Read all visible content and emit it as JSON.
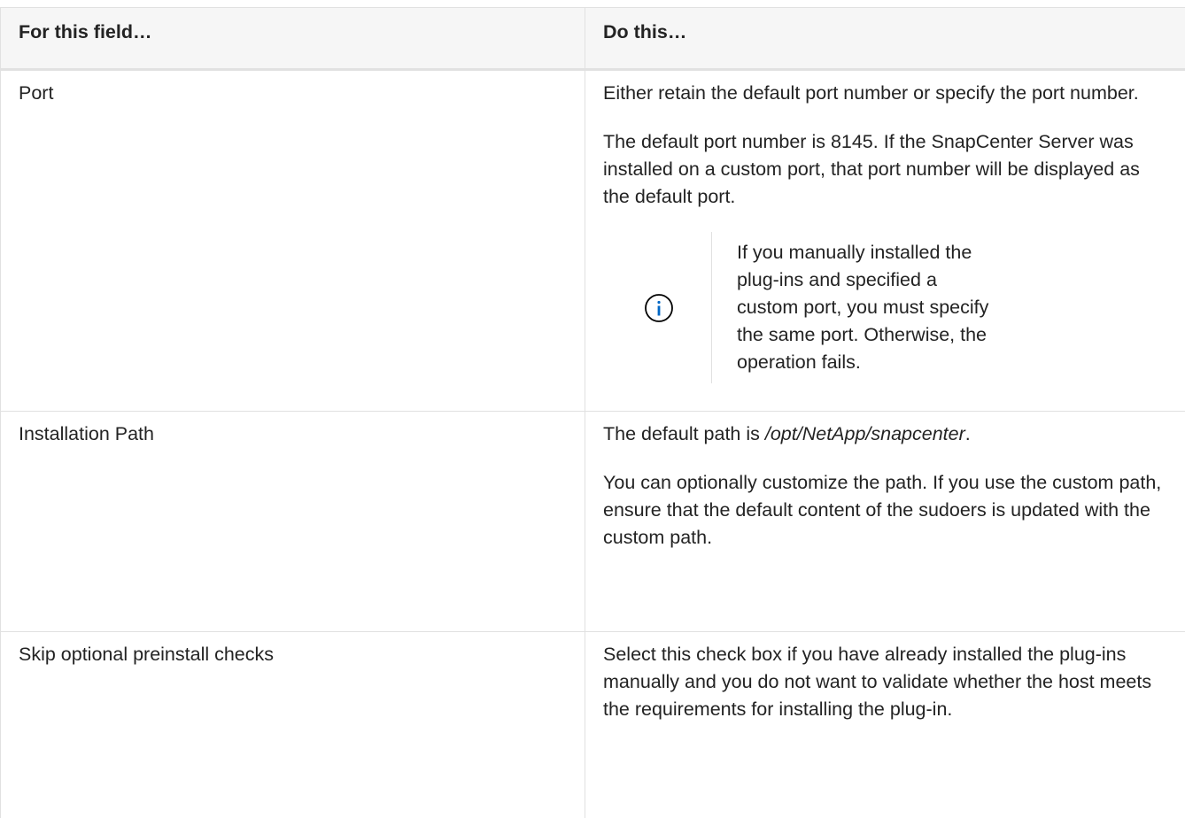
{
  "table": {
    "headers": [
      "For this field…",
      "Do this…"
    ],
    "rows": [
      {
        "field": "Port",
        "paragraphs": [
          "Either retain the default port number or specify the port number.",
          "The default port number is 8145. If the SnapCenter Server was installed on a custom port, that port number will be displayed as the default port."
        ],
        "note": {
          "icon": "info-icon",
          "text": "If you manually installed the plug-ins and specified a custom port, you must specify the same port. Otherwise, the operation fails."
        }
      },
      {
        "field": "Installation Path",
        "paragraphs": [
          {
            "prefix": "The default path is ",
            "emphasis": "/opt/NetApp/snapcenter",
            "suffix": "."
          },
          "You can optionally customize the path. If you use the custom path, ensure that the default content of the sudoers is updated with the custom path."
        ]
      },
      {
        "field": "Skip optional preinstall checks",
        "paragraphs": [
          "Select this check box if you have already installed the plug-ins manually and you do not want to validate whether the host meets the requirements for installing the plug-in."
        ]
      }
    ]
  },
  "colors": {
    "text": "#232323",
    "border": "#e1e1e1",
    "header_bg": "#f6f6f6",
    "info_icon": "#0067c5"
  }
}
